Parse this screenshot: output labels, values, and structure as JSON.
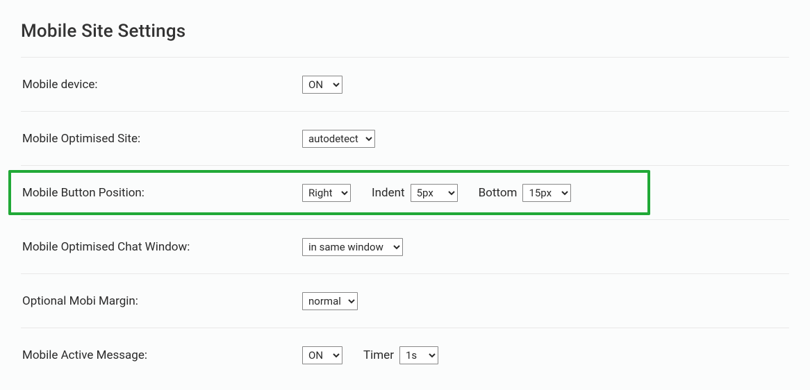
{
  "page": {
    "title": "Mobile Site Settings"
  },
  "rows": {
    "mobile_device": {
      "label": "Mobile device:",
      "value": "ON"
    },
    "mobile_optimised_site": {
      "label": "Mobile Optimised Site:",
      "value": "autodetect"
    },
    "mobile_button_position": {
      "label": "Mobile Button Position:",
      "side_value": "Right",
      "indent_label": "Indent",
      "indent_value": "5px",
      "bottom_label": "Bottom",
      "bottom_value": "15px"
    },
    "mobile_chat_window": {
      "label": "Mobile Optimised Chat Window:",
      "value": "in same window"
    },
    "mobi_margin": {
      "label": "Optional Mobi Margin:",
      "value": "normal"
    },
    "active_message": {
      "label": "Mobile Active Message:",
      "value": "ON",
      "timer_label": "Timer",
      "timer_value": "1s"
    }
  }
}
